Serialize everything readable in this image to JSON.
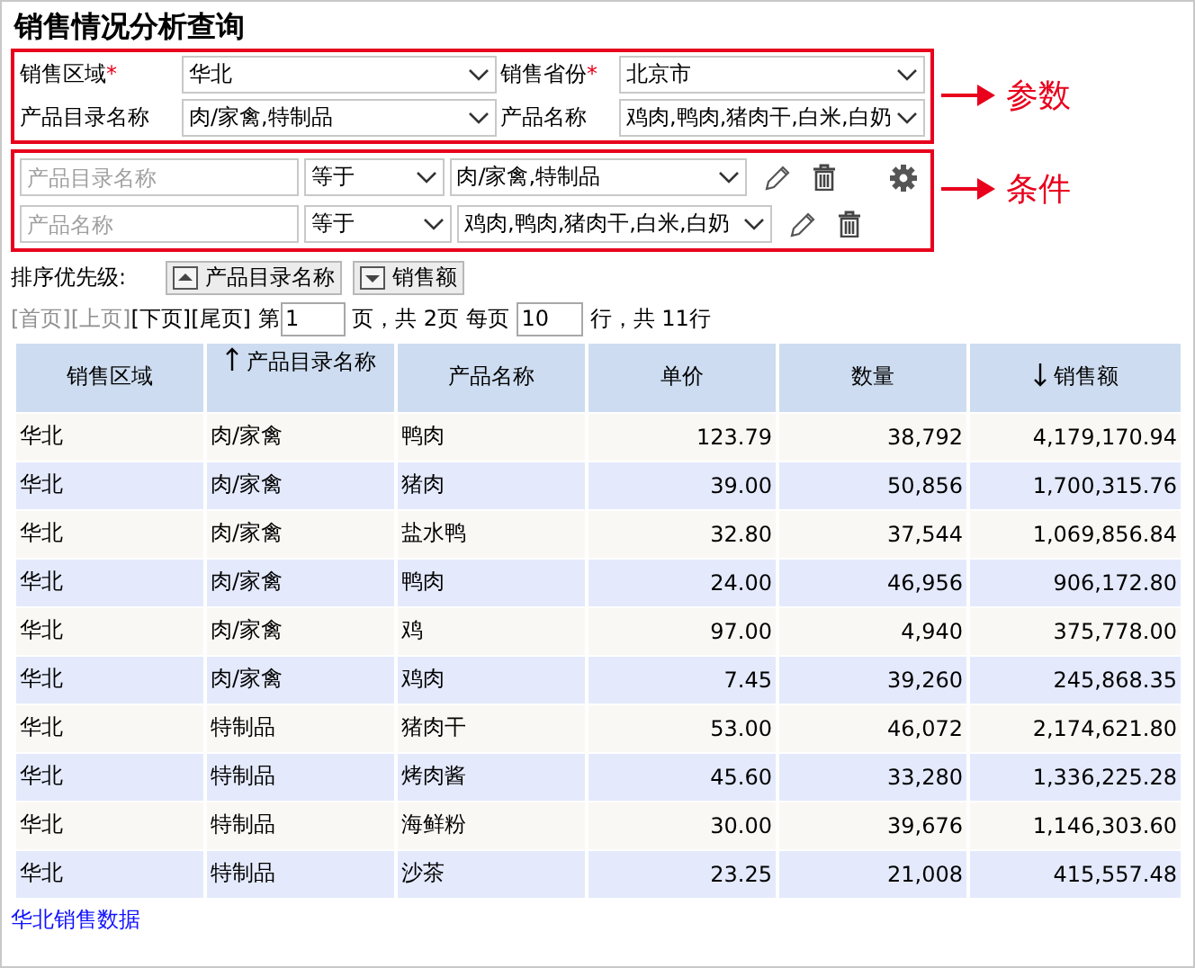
{
  "title": "销售情况分析查询",
  "parameters": [
    {
      "label": "销售区域",
      "required_mark": "*",
      "value": "华北"
    },
    {
      "label": "销售省份",
      "required_mark": "*",
      "value": "北京市"
    },
    {
      "label": "产品目录名称",
      "value": "肉/家禽,特制品"
    },
    {
      "label": "产品名称",
      "value": "鸡肉,鸭肉,猪肉干,白米,白奶"
    }
  ],
  "conditions": [
    {
      "placeholder": "产品目录名称",
      "operator": "等于",
      "value": "肉/家禽,特制品",
      "settings": true
    },
    {
      "placeholder": "产品名称",
      "operator": "等于",
      "value": "鸡肉,鸭肉,猪肉干,白米,白奶",
      "settings": false
    }
  ],
  "annotations": [
    {
      "label": "参数"
    },
    {
      "label": "条件"
    }
  ],
  "sort_priority": {
    "label": "排序优先级:",
    "items": [
      {
        "label": "产品目录名称",
        "ascending": true
      },
      {
        "label": "销售额",
        "ascending": false
      }
    ]
  },
  "pager": {
    "links": [
      {
        "label": "[首页]",
        "disabled": true
      },
      {
        "label": "[上页]",
        "disabled": true
      },
      {
        "label": "[下页]",
        "disabled": false
      },
      {
        "label": "[尾页]",
        "disabled": false
      }
    ],
    "page_prefix": "第",
    "page": "1",
    "page_suffix": "页，共 2页 每页",
    "rows_per_page": "10",
    "total": "行，共 11行"
  },
  "table": {
    "columns": [
      {
        "label": "销售区域",
        "numeric": false,
        "sorted_ascending": false,
        "sorted_descending": false
      },
      {
        "label": "产品目录名称",
        "numeric": false,
        "sorted_ascending": true,
        "sorted_descending": false
      },
      {
        "label": "产品名称",
        "numeric": false,
        "sorted_ascending": false,
        "sorted_descending": false
      },
      {
        "label": "单价",
        "numeric": true,
        "sorted_ascending": false,
        "sorted_descending": false
      },
      {
        "label": "数量",
        "numeric": true,
        "sorted_ascending": false,
        "sorted_descending": false
      },
      {
        "label": "销售额",
        "numeric": true,
        "sorted_ascending": false,
        "sorted_descending": true
      }
    ],
    "rows": [
      [
        "华北",
        "肉/家禽",
        "鸭肉",
        "123.79",
        "38,792",
        "4,179,170.94"
      ],
      [
        "华北",
        "肉/家禽",
        "猪肉",
        "39.00",
        "50,856",
        "1,700,315.76"
      ],
      [
        "华北",
        "肉/家禽",
        "盐水鸭",
        "32.80",
        "37,544",
        "1,069,856.84"
      ],
      [
        "华北",
        "肉/家禽",
        "鸭肉",
        "24.00",
        "46,956",
        "906,172.80"
      ],
      [
        "华北",
        "肉/家禽",
        "鸡",
        "97.00",
        "4,940",
        "375,778.00"
      ],
      [
        "华北",
        "肉/家禽",
        "鸡肉",
        "7.45",
        "39,260",
        "245,868.35"
      ],
      [
        "华北",
        "特制品",
        "猪肉干",
        "53.00",
        "46,072",
        "2,174,621.80"
      ],
      [
        "华北",
        "特制品",
        "烤肉酱",
        "45.60",
        "33,280",
        "1,336,225.28"
      ],
      [
        "华北",
        "特制品",
        "海鲜粉",
        "30.00",
        "39,676",
        "1,146,303.60"
      ],
      [
        "华北",
        "特制品",
        "沙茶",
        "23.25",
        "21,008",
        "415,557.48"
      ]
    ]
  },
  "footer_link": "华北销售数据"
}
